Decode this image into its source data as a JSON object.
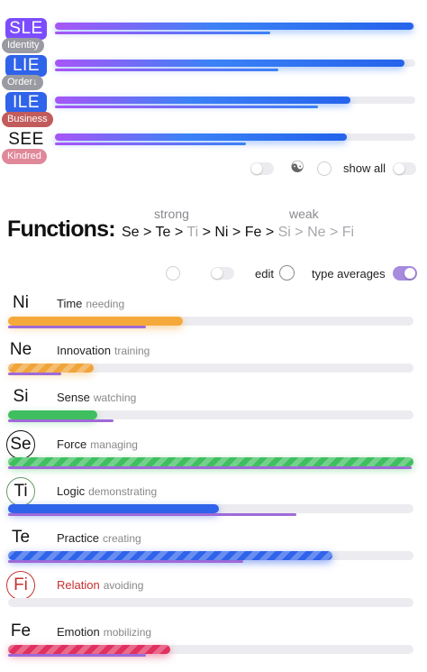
{
  "types": [
    {
      "code": "SLE",
      "label": "Identity",
      "badge_color": "#7c4dff",
      "label_color": "#9a9aa2",
      "fill": 0.995,
      "sub": 0.598
    },
    {
      "code": "LIE",
      "label": "Order↓",
      "badge_color": "#2f63ea",
      "label_color": "#9a9aa2",
      "fill": 0.97,
      "sub": 0.62
    },
    {
      "code": "ILE",
      "label": "Business",
      "badge_color": "#2f63ea",
      "label_color": "#c25b5b",
      "fill": 0.82,
      "sub": 0.73
    },
    {
      "code": "SEE",
      "label": "Kindred",
      "badge_color": "",
      "label_color": "#e0889a",
      "fill": 0.81,
      "sub": 0.53
    }
  ],
  "controls_top": {
    "show_all_label": "show all",
    "yin_yang_icon": "☯"
  },
  "functions_header": {
    "title": "Functions:",
    "strong_label": "strong",
    "weak_label": "weak",
    "sequence": [
      {
        "t": "Se",
        "muted": false
      },
      {
        "t": " > ",
        "muted": false
      },
      {
        "t": "Te",
        "muted": false
      },
      {
        "t": " > ",
        "muted": false
      },
      {
        "t": "Ti",
        "muted": true
      },
      {
        "t": " > ",
        "muted": false
      },
      {
        "t": "Ni",
        "muted": false
      },
      {
        "t": " > ",
        "muted": false
      },
      {
        "t": "Fe",
        "muted": false
      },
      {
        "t": " > ",
        "muted": false
      },
      {
        "t": "Si",
        "muted": true
      },
      {
        "t": " > ",
        "muted": true
      },
      {
        "t": "Ne",
        "muted": true
      },
      {
        "t": " > ",
        "muted": true
      },
      {
        "t": "Fi",
        "muted": true
      }
    ]
  },
  "controls_mid": {
    "edit_label": "edit",
    "type_averages_label": "type averages",
    "type_averages_on": true
  },
  "functions": [
    {
      "sym": "Ni",
      "name": "Time",
      "note": "needing",
      "style": "plain",
      "color": "#f6a93b",
      "glow": "rgba(246,169,59,0.5)",
      "fill": 0.43,
      "sub": 0.34,
      "striped": false
    },
    {
      "sym": "Ne",
      "name": "Innovation",
      "note": "training",
      "style": "plain",
      "color": "#f0a43a",
      "glow": "rgba(240,164,58,0.4)",
      "fill": 0.21,
      "sub": 0.13,
      "striped": true
    },
    {
      "sym": "Si",
      "name": "Sense",
      "note": "watching",
      "style": "plain",
      "color": "#3fbf5f",
      "glow": "rgba(63,191,95,0.4)",
      "fill": 0.22,
      "sub": 0.26,
      "striped": false
    },
    {
      "sym": "Se",
      "name": "Force",
      "note": "managing",
      "style": "circled",
      "color": "#3fbf5f",
      "glow": "rgba(63,191,95,0.55)",
      "fill": 1.0,
      "sub": 0.995,
      "striped": true
    },
    {
      "sym": "Ti",
      "name": "Logic",
      "note": "demonstrating",
      "style": "circled-light",
      "color": "#2f63ea",
      "glow": "rgba(47,99,234,0.5)",
      "fill": 0.52,
      "sub": 0.71,
      "striped": false
    },
    {
      "sym": "Te",
      "name": "Practice",
      "note": "creating",
      "style": "plain",
      "color": "#2f63ea",
      "glow": "rgba(47,99,234,0.55)",
      "fill": 0.8,
      "sub": 0.58,
      "striped": true
    },
    {
      "sym": "Fi",
      "name": "Relation",
      "note": "avoiding",
      "style": "circled-red",
      "color": "#c53030",
      "glow": "rgba(197,48,48,0.3)",
      "fill": 0.0,
      "sub": 0.0,
      "striped": false
    },
    {
      "sym": "Fe",
      "name": "Emotion",
      "note": "mobilizing",
      "style": "plain",
      "color": "#e0305f",
      "glow": "rgba(224,48,95,0.5)",
      "fill": 0.4,
      "sub": 0.34,
      "striped": true
    }
  ]
}
